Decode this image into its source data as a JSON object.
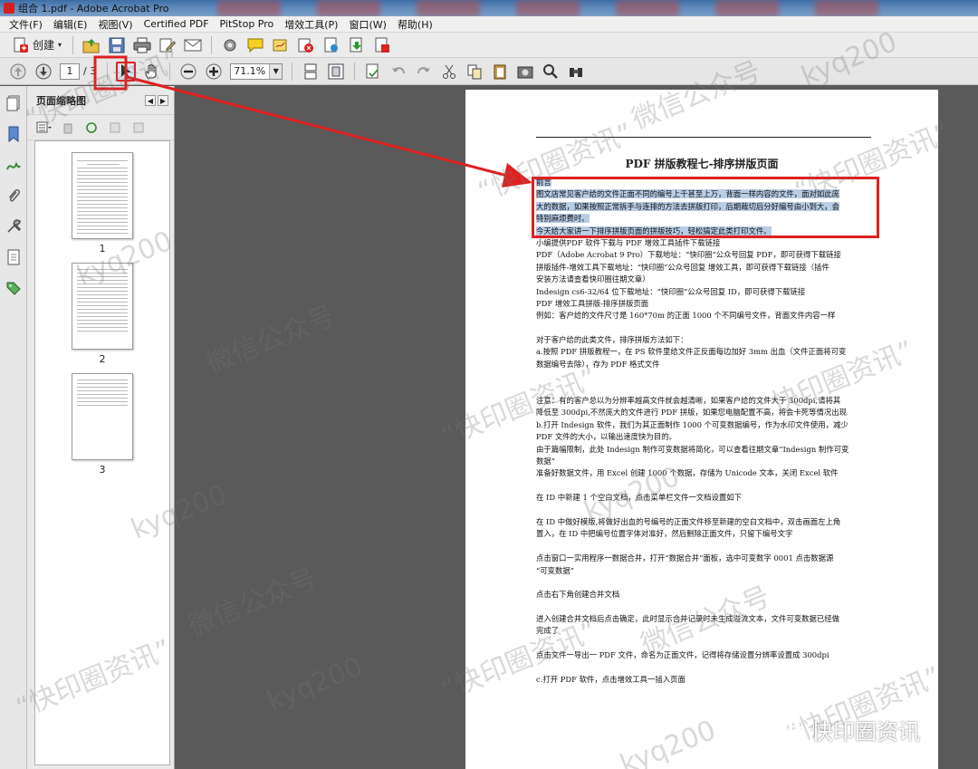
{
  "window": {
    "title": "组合 1.pdf - Adobe Acrobat Pro"
  },
  "menu": [
    "文件(F)",
    "编辑(E)",
    "视图(V)",
    "Certified PDF",
    "PitStop Pro",
    "增效工具(P)",
    "窗口(W)",
    "帮助(H)"
  ],
  "toolbar": {
    "create_label": "创建",
    "page_current": "1",
    "page_total": "/ 3",
    "zoom": "71.1%"
  },
  "panel": {
    "title": "页面缩略图",
    "thumbnails": [
      {
        "label": "1"
      },
      {
        "label": "2"
      },
      {
        "label": "3"
      }
    ]
  },
  "document": {
    "title": "PDF 拼版教程七-排序拼版页面",
    "lines": [
      {
        "text": "前言",
        "highlight": true
      },
      {
        "text": "图文店常见客户给的文件正面不同的编号上千甚至上万，背面一样内容的文件，面对如此庞",
        "highlight": true
      },
      {
        "text": "大的数据，如果按照正常拆手与连排的方法去拼版打印，后期裁切后分好编号由小到大，会",
        "highlight": true
      },
      {
        "text": "特别麻烦费时。",
        "highlight": true
      },
      {
        "text": "今天给大家讲一下排序拼版页面的拼版技巧，轻松搞定此类打印文件。",
        "highlight": true
      },
      {
        "text": "小编提供PDF 软件下载与 PDF 增效工具插件下载链接"
      },
      {
        "text": "PDF（Adobe Acrobat 9 Pro）下载地址：“快印圈”公众号回复 PDF，即可获得下载链接"
      },
      {
        "text": "拼版插件-增效工具下载地址：“快印圈”公众号回复 增效工具，即可获得下载链接（插件"
      },
      {
        "text": "安装方法请查看快印圈往期文章）"
      },
      {
        "text": "Indesign cs6-32/64 位下载地址：“快印圈”公众号回复 ID，即可获得下载链接"
      },
      {
        "text": "PDF 增效工具拼版-排序拼版页面"
      },
      {
        "text": "例如：客户给的文件尺寸是 160*70m 的正面 1000 个不同编号文件，背面文件内容一样"
      },
      {
        "text": ""
      },
      {
        "text": "对于客户给的此类文件，排序拼版方法如下："
      },
      {
        "text": "a.按照 PDF 拼版教程一，在 PS 软件里给文件正反面每边加好 3mm 出血（文件正面将可变"
      },
      {
        "text": "数据编号去除），存为 PDF 格式文件"
      },
      {
        "text": ""
      },
      {
        "text": ""
      },
      {
        "text": "注意：有的客户总以为分辨率越高文件就会越清晰，如果客户给的文件大于 300dpi,请将其"
      },
      {
        "text": "降低至 300dpi,不然庞大的文件进行 PDF 拼版，如果您电脑配置不高，将会卡死等情况出现"
      },
      {
        "text": "b.打开 Indesign 软件，我们为其正面制作 1000 个可变数据编号，作为水印文件使用，减少"
      },
      {
        "text": "PDF 文件的大小，以输出速度快为目的。"
      },
      {
        "text": "由于篇幅限制，此处 Indesign 制作可变数据将简化，可以查看往期文章“Indesign 制作可变"
      },
      {
        "text": "数据”"
      },
      {
        "text": "准备好数据文件，用 Excel 创建 1000 个数据，存储为 Unicode 文本，关闭 Excel 软件"
      },
      {
        "text": ""
      },
      {
        "text": "在 ID 中新建 1 个空白文档，点击菜单栏文件一文档设置如下"
      },
      {
        "text": ""
      },
      {
        "text": "在 ID 中做好模版,将做好出血的号编号的正面文件移至新建的空白文档中，双击画面左上角"
      },
      {
        "text": "置入，在 ID 中把编号位置字体对准好，然后删除正面文件，只留下编号文字"
      },
      {
        "text": ""
      },
      {
        "text": "点击窗口一实用程序一数据合并，打开“数据合并”面板，选中可变数字 0001 点击数据源"
      },
      {
        "text": "“可变数据”"
      },
      {
        "text": ""
      },
      {
        "text": "点击右下角创建合并文档"
      },
      {
        "text": ""
      },
      {
        "text": "进入创建合并文档后点击确定，此时显示合并记录时未生成溢流文本，文件可变数据已经做"
      },
      {
        "text": "完成了"
      },
      {
        "text": ""
      },
      {
        "text": "点击文件一导出一 PDF 文件，命名为正面文件，记得将存储设置分辨率设置成 300dpi"
      },
      {
        "text": ""
      },
      {
        "text": "c.打开 PDF 软件，点击增效工具一插入页面"
      }
    ]
  },
  "watermarks": [
    "“快印圈资讯”",
    "微信公众号",
    "kyq200"
  ],
  "brand": {
    "name": "快印圈资讯"
  },
  "colors": {
    "highlight_box": "#e02020",
    "text_highlight": "#b8cde6",
    "title_bar": "#3c6da6"
  },
  "icons": [
    "create-icon",
    "open-icon",
    "save-icon",
    "print-icon",
    "edit-icon",
    "mail-icon",
    "settings-icon",
    "comment-icon",
    "sign-icon",
    "security-icon",
    "prev-page-icon",
    "next-page-icon",
    "select-icon",
    "hand-icon",
    "zoom-out-icon",
    "zoom-in-icon",
    "fit-page-icon",
    "search-icon"
  ]
}
